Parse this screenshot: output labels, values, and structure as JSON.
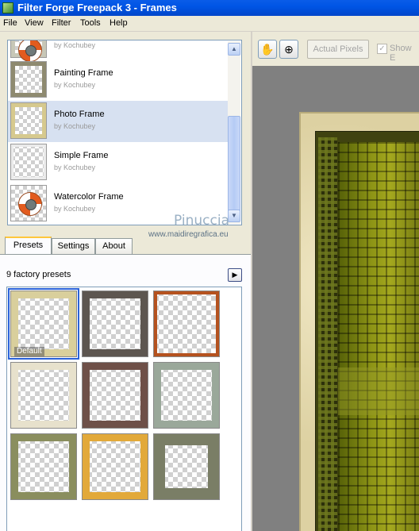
{
  "window": {
    "title": "Filter Forge Freepack 3 - Frames"
  },
  "menu": [
    "File",
    "View",
    "Filter",
    "Tools",
    "Help"
  ],
  "filter_list": {
    "items": [
      {
        "name": "",
        "author": "by Kochubey"
      },
      {
        "name": "Painting Frame",
        "author": "by Kochubey"
      },
      {
        "name": "Photo Frame",
        "author": "by Kochubey"
      },
      {
        "name": "Simple Frame",
        "author": "by Kochubey"
      },
      {
        "name": "Watercolor Frame",
        "author": "by Kochubey"
      }
    ],
    "selected": "Photo Frame"
  },
  "watermark": {
    "line1": "Pinuccia",
    "line2": "www.maidiregrafica.eu"
  },
  "tabs": [
    "Presets",
    "Settings",
    "About"
  ],
  "active_tab": "Presets",
  "presets": {
    "count_label": "9 factory presets",
    "default_label": "Default",
    "frame_colors": [
      "#d9cf9c",
      "#5d5650",
      "#b5521f",
      "#e7e1cc",
      "#6e5048",
      "#9aa89a",
      "#8a8e5e",
      "#e2a93a",
      "#7a7e66"
    ]
  },
  "toolbar": {
    "actual_pixels": "Actual Pixels",
    "show_label": "Show E"
  },
  "icons": {
    "hand": "hand-tool-icon",
    "zoom": "zoom-icon"
  }
}
